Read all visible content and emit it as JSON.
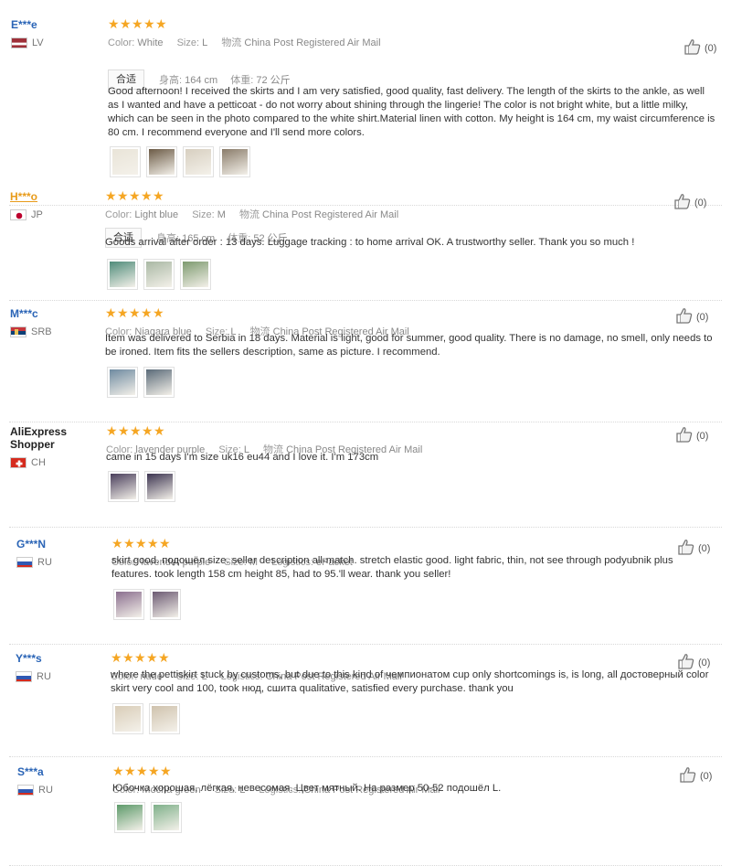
{
  "labels": {
    "color": "Color:",
    "size": "Size:",
    "logistics_cn": "物流",
    "logistics_en": "Logistics:",
    "fit_tag": "合适",
    "height": "身高:",
    "weight": "体重:"
  },
  "reviews": [
    {
      "name": "E***e",
      "country": "LV",
      "stars": 5,
      "likes": "(0)",
      "color": "White",
      "size": "L",
      "logistics_label": "物流",
      "logistics": "China Post Registered Air Mail",
      "has_fit": true,
      "height": "164 cm",
      "weight": "72 公斤",
      "text": "Good afternoon! I received the skirts and I am very satisfied, good quality, fast delivery. The length of the skirts to the ankle, as well as I wanted and have a petticoat - do not worry about shining through the lingerie! The color is not bright white, but a little milky, which can be seen in the photo compared to the white shirt.Material linen with cotton. My height is 164 cm, my waist circumference is 80 cm. I recommend everyone and I'll send more colors.",
      "photos": 4
    },
    {
      "name": "H***o",
      "country": "JP",
      "stars": 5,
      "likes": "(0)",
      "color": "Light blue",
      "size": "M",
      "logistics_label": "物流",
      "logistics": "China Post Registered Air Mail",
      "has_fit": true,
      "height": "165 cm",
      "weight": "52 公斤",
      "text": "Goods arrival after order : 13 days. Luggage tracking : to home arrival OK. A trustworthy seller. Thank you so much !",
      "photos": 3
    },
    {
      "name": "M***c",
      "country": "SRB",
      "stars": 5,
      "likes": "(0)",
      "color": "Niagara blue",
      "size": "L",
      "logistics_label": "物流",
      "logistics": "China Post Registered Air Mail",
      "has_fit": false,
      "text": "Item was delivered to Serbia in 18 days. Material is light, good for summer, good quality. There is no damage, no smell, only needs to be ironed. Item fits the sellers description, same as picture. I recommend.",
      "photos": 2
    },
    {
      "name": "AliExpress Shopper",
      "country": "CH",
      "stars": 5,
      "likes": "(0)",
      "color": "lavender purple",
      "size": "L",
      "logistics_label": "物流",
      "logistics": "China Post Registered Air Mail",
      "has_fit": false,
      "text": "came in 15 days I'm size uk16 eu44 and I love it. I'm 173cm",
      "photos": 2
    },
    {
      "name": "G***N",
      "country": "RU",
      "stars": 5,
      "likes": "(0)",
      "color": "lavender purple",
      "size": "M",
      "logistics_label": "Logistics:",
      "logistics": "ePacket",
      "has_fit": false,
      "text": "skirt good. подошёл size. seller description all-match. stretch elastic good. light fabric, thin, not see through podyubnik plus features. took length 158 cm height 85, had to 95.'ll wear. thank you seller!",
      "photos": 2
    },
    {
      "name": "Y***s",
      "country": "RU",
      "stars": 5,
      "likes": "(0)",
      "color": "nude",
      "size": "L",
      "logistics_label": "Logistics:",
      "logistics": "China Post Registered Air Mail",
      "has_fit": false,
      "text": "where the pettiskirt stuck by customs, but due to this kind of чемпионатом cup only shortcomings is, is long, all достоверный color skirt very cool and 100, took нюд, сшита qualitative, satisfied every purchase. thank you",
      "photos": 2
    },
    {
      "name": "S***a",
      "country": "RU",
      "stars": 5,
      "likes": "(0)",
      "color": "Mocha green",
      "size": "L",
      "logistics_label": "Logistics:",
      "logistics": "China Post Registered Air Mail",
      "has_fit": false,
      "text": "Юбочка хорошая, лёгкая, невесомая. Цвет мятный. На размер 50-52 подошёл L.",
      "photos": 2
    }
  ],
  "colors": {
    "star": "#f5a623",
    "name": "#2a64b6",
    "name_gold": "#e89b1a"
  },
  "icons": {
    "like": "thumbs-up-icon",
    "star": "star-icon"
  }
}
